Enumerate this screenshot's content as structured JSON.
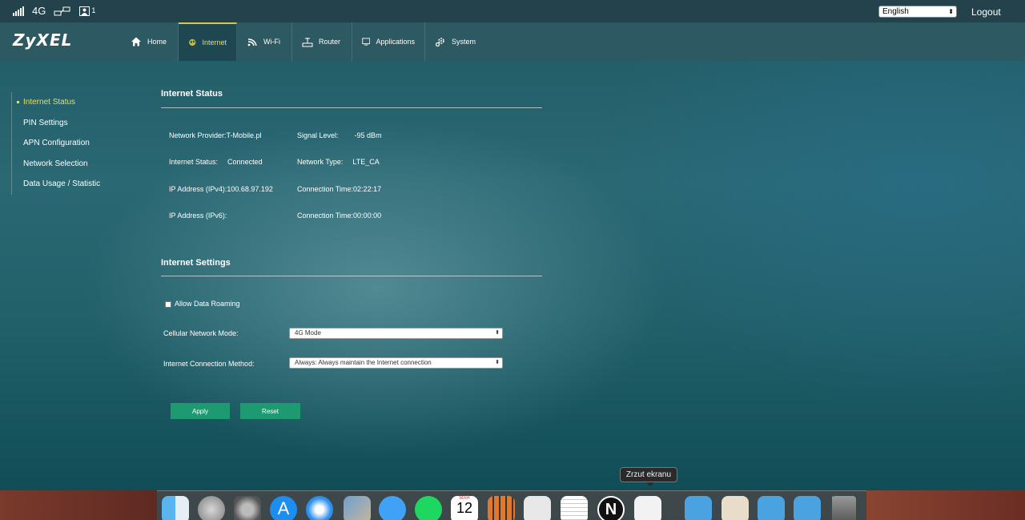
{
  "status_bar": {
    "network_type": "4G",
    "device_count": "1",
    "language": "English",
    "logout_label": "Logout"
  },
  "brand": "ZyXEL",
  "nav": {
    "items": [
      {
        "label": "Home",
        "icon": "home-icon"
      },
      {
        "label": "Internet",
        "icon": "globe-icon",
        "active": true
      },
      {
        "label": "Wi-Fi",
        "icon": "wifi-icon"
      },
      {
        "label": "Router",
        "icon": "router-icon"
      },
      {
        "label": "Applications",
        "icon": "monitor-icon"
      },
      {
        "label": "System",
        "icon": "gear-icon"
      }
    ]
  },
  "sidebar": {
    "items": [
      {
        "label": "Internet Status",
        "active": true
      },
      {
        "label": "PIN Settings"
      },
      {
        "label": "APN Configuration"
      },
      {
        "label": "Network Selection"
      },
      {
        "label": "Data Usage / Statistic"
      }
    ]
  },
  "internet_status": {
    "title": "Internet Status",
    "network_provider_label": "Network Provider:",
    "network_provider": "T-Mobile.pl",
    "signal_level_label": "Signal Level:",
    "signal_level": "-95 dBm",
    "internet_status_label": "Internet Status:",
    "internet_status": "Connected",
    "network_type_label": "Network Type:",
    "network_type": "LTE_CA",
    "ipv4_label": "IP Address (IPv4):",
    "ipv4": "100.68.97.192",
    "connection_time_label": "Connection Time:",
    "connection_time_1": "02:22:17",
    "ipv6_label": "IP Address (IPv6):",
    "ipv6": "",
    "connection_time_2": "00:00:00"
  },
  "internet_settings": {
    "title": "Internet Settings",
    "allow_roaming_label": "Allow Data Roaming",
    "allow_roaming_checked": false,
    "cellular_mode_label": "Cellular Network Mode:",
    "cellular_mode_value": "4G Mode",
    "connection_method_label": "Internet Connection Method:",
    "connection_method_value": "Always: Always maintain the Internet connection",
    "apply_label": "Apply",
    "reset_label": "Reset"
  },
  "dock": {
    "tooltip": "Zrzut ekranu",
    "calendar_month": "MAR",
    "calendar_day": "12",
    "icons": [
      "finder-icon",
      "launchpad-icon",
      "system-preferences-icon",
      "app-store-icon",
      "safari-icon",
      "mail-icon",
      "messages-icon",
      "spotify-icon",
      "calendar-icon",
      "calculator-icon",
      "preview-icon",
      "textedit-icon",
      "notion-icon",
      "screenshot-icon",
      "applications-folder-icon",
      "home-folder-icon",
      "documents-folder-icon",
      "downloads-folder-icon",
      "trash-icon"
    ]
  }
}
